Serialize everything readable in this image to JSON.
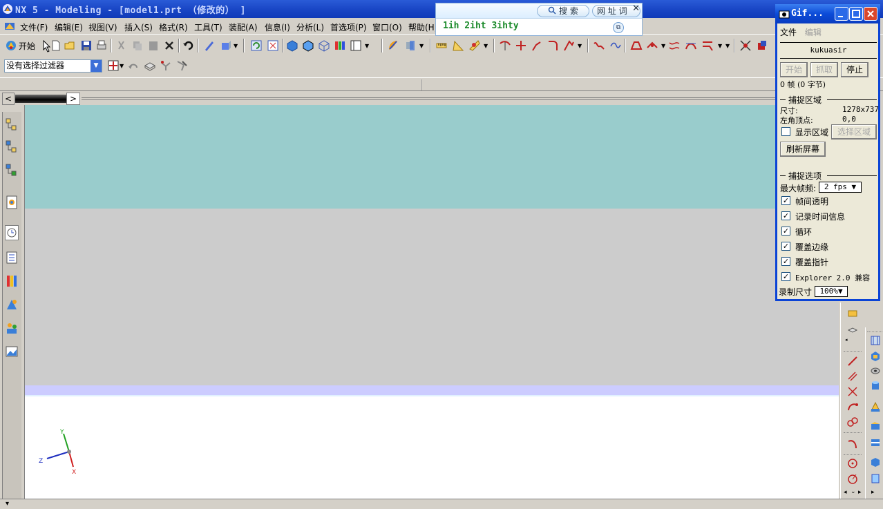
{
  "window": {
    "title": "NX 5 - Modeling - [model1.prt （修改的） ]"
  },
  "menu": {
    "items": [
      "文件(F)",
      "编辑(E)",
      "视图(V)",
      "插入(S)",
      "格式(R)",
      "工具(T)",
      "装配(A)",
      "信息(I)",
      "分析(L)",
      "首选项(P)",
      "窗口(O)",
      "帮助(H)"
    ]
  },
  "toolbar": {
    "start_label": "开始",
    "filter_value": "没有选择过滤器"
  },
  "dictionary": {
    "search_label": "搜 索",
    "web_label": "网 址 词",
    "close_label": "✕",
    "result_text": "1ih 2iht 3ihty"
  },
  "gif_capture": {
    "title": "Gif...",
    "menu_file": "文件",
    "menu_edit": "编辑",
    "filename": "kukuasir",
    "btn_start": "开始",
    "btn_capture": "抓取",
    "btn_stop": "停止",
    "frame_info": "0 帧 (0 字节)",
    "section_region": "捕捉区域",
    "size_label": "尺寸:",
    "size_value": "1278x737",
    "corner_label": "左角顶点:",
    "corner_value": "0,0",
    "show_region_label": "显示区域",
    "select_region_label": "选择区域",
    "refresh_label": "刷新屏幕",
    "section_options": "捕捉选项",
    "max_fps_label": "最大帧频:",
    "max_fps_value": "2 fps",
    "opt_transparent": "帧间透明",
    "opt_time": "记录时间信息",
    "opt_loop": "循环",
    "opt_edge": "覆盖边缘",
    "opt_pointer": "覆盖指针",
    "opt_explorer": "Explorer 2.0 兼容",
    "record_size_label": "录制尺寸",
    "record_size_value": "100%"
  },
  "triad": {
    "x_label": "X",
    "y_label": "Y",
    "z_label": "Z"
  },
  "colors": {
    "title_blue": "#1a47c6",
    "viewport_teal": "#99cccc",
    "viewport_grey": "#cccccc",
    "viewport_lavender": "#ccccff",
    "dict_green": "#1a8a2a"
  }
}
